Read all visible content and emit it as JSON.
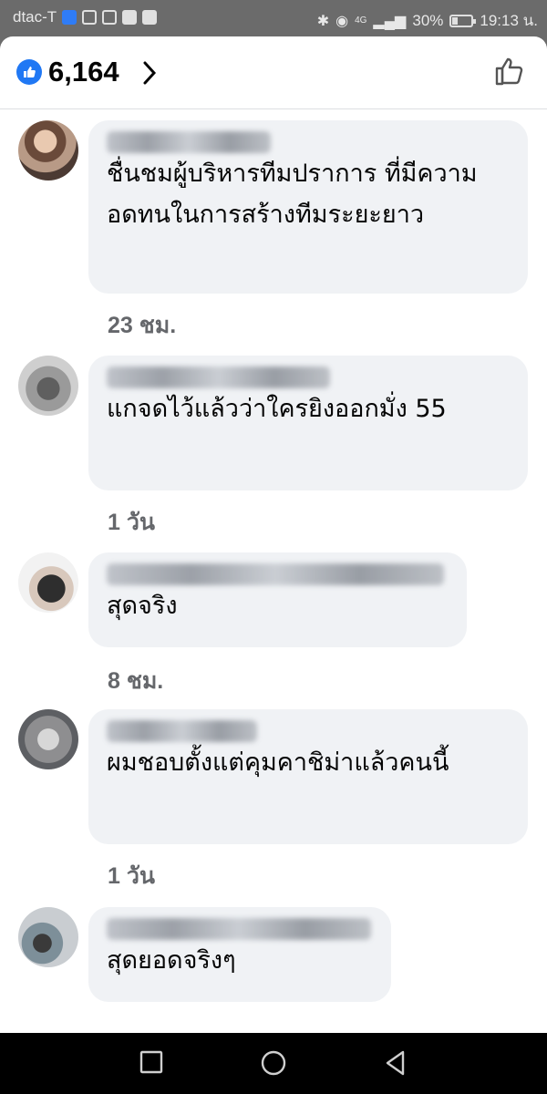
{
  "status_bar": {
    "carrier": "dtac-T",
    "bluetooth_icon": "bluetooth-icon",
    "eye_icon": "eye-comfort-icon",
    "network": "4G",
    "battery": "30%",
    "battery_level": 0.3,
    "time": "19:13 น."
  },
  "header": {
    "reactions_count": "6,164",
    "like_icon": "like-badge-icon",
    "chevron_icon": "chevron-right-icon",
    "thumb_icon": "thumbs-up-outline-icon",
    "accent_color": "#2078f4"
  },
  "comments": [
    {
      "text": "ชื่นชมผู้บริหารทีมปราการ ที่มีความอดทนในการสร้างทีมระยะยาว",
      "time": "23 ชม."
    },
    {
      "text": "แกจดไว้แล้วว่าใครยิงออกมั่ง 55",
      "time": "1 วัน"
    },
    {
      "text": "สุดจริง",
      "time": "8 ชม."
    },
    {
      "text": "ผมชอบตั้งแต่คุมคาชิม่าแล้วคนนี้",
      "time": "1 วัน"
    },
    {
      "text": "สุดยอดจริงๆ",
      "time": ""
    }
  ],
  "nav": {
    "recents_icon": "square-recents-icon",
    "home_icon": "circle-home-icon",
    "back_icon": "triangle-back-icon"
  }
}
